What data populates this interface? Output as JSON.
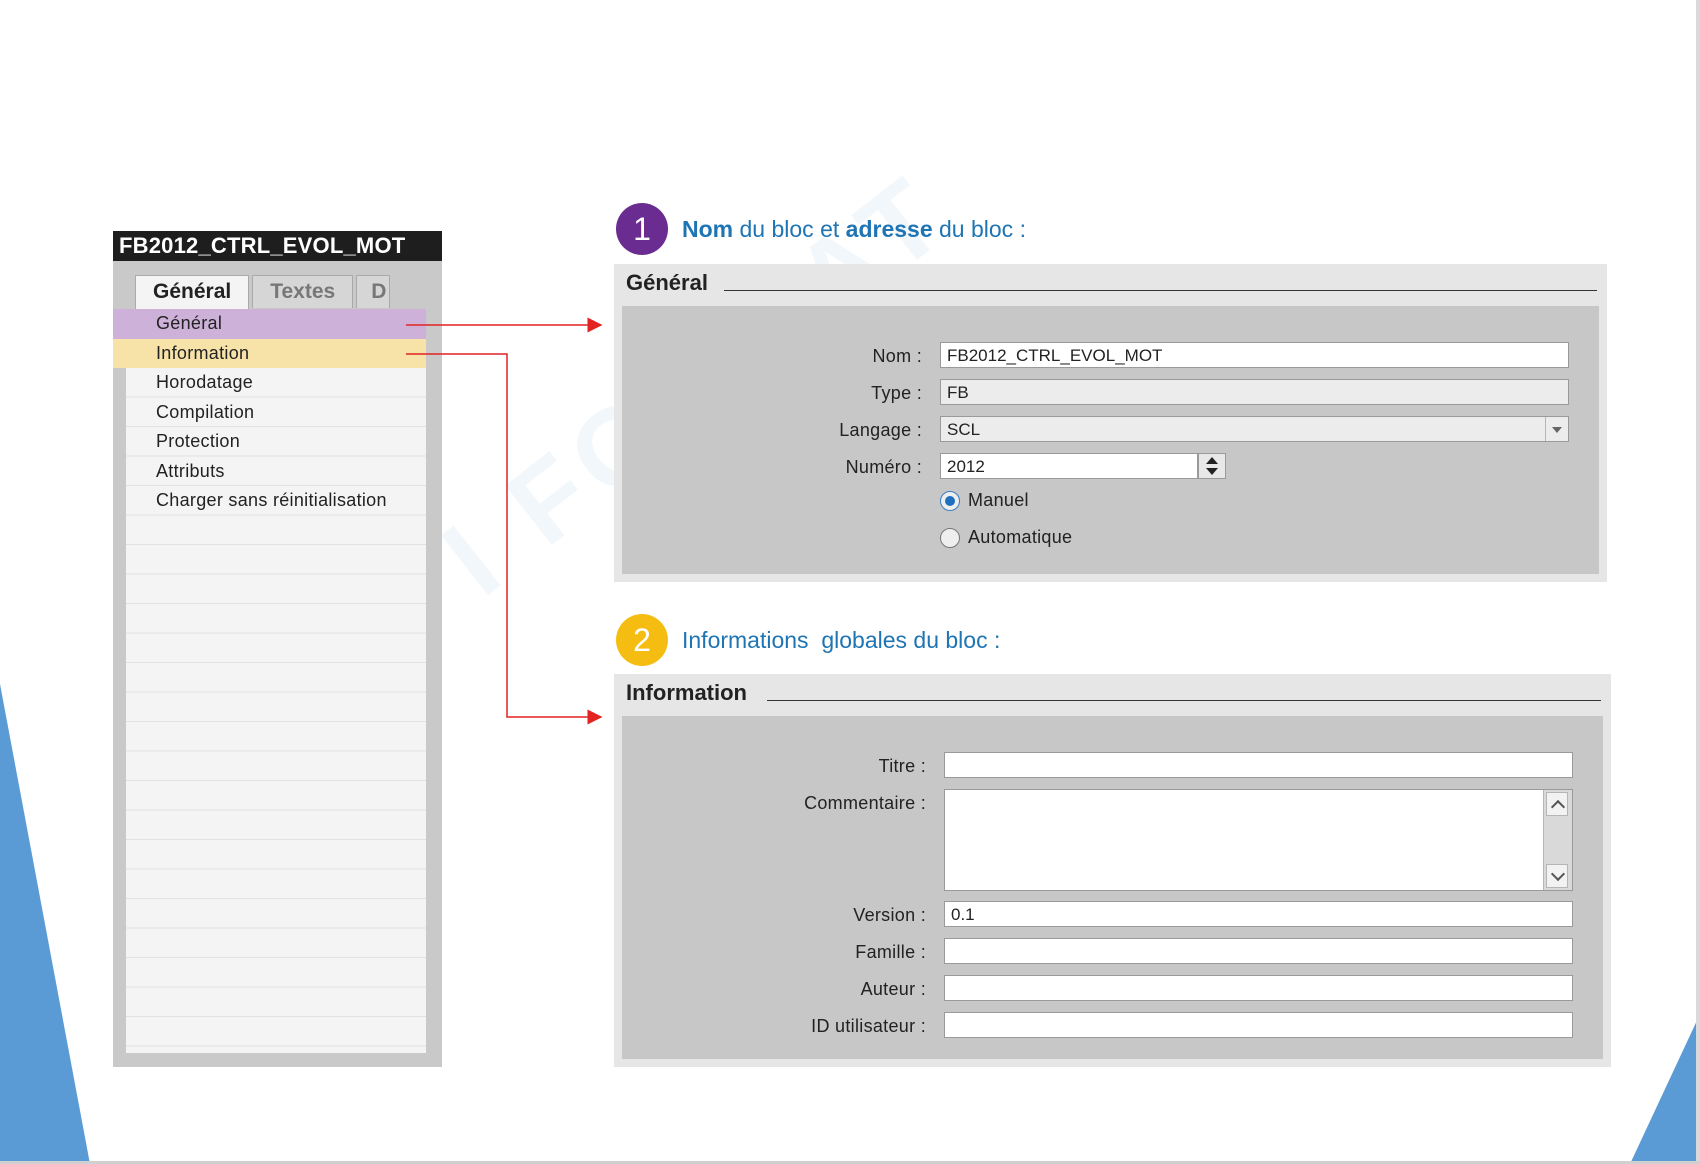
{
  "colors": {
    "accent_blue": "#1f74b3",
    "badge_purple": "#6a2c91",
    "badge_yellow": "#f5bd12",
    "selection_purple": "#cdb1d9",
    "selection_yellow": "#f7e3a8",
    "connector_red": "#e32222"
  },
  "left_panel": {
    "title": "FB2012_CTRL_EVOL_MOT",
    "tabs": [
      {
        "label": "Général",
        "active": true
      },
      {
        "label": "Textes",
        "active": false
      },
      {
        "label": "D",
        "active": false
      }
    ],
    "nav": [
      {
        "label": "Général",
        "highlight": "purple"
      },
      {
        "label": "Information",
        "highlight": "yellow"
      },
      {
        "label": "Horodatage"
      },
      {
        "label": "Compilation"
      },
      {
        "label": "Protection"
      },
      {
        "label": "Attributs"
      },
      {
        "label": "Charger sans réinitialisation"
      }
    ]
  },
  "section1": {
    "number": "1",
    "heading_bold1": "Nom",
    "heading_mid": " du bloc et ",
    "heading_bold2": "adresse",
    "heading_end": " du bloc :",
    "panel_title": "Général",
    "fields": {
      "nom": {
        "label": "Nom :",
        "value": "FB2012_CTRL_EVOL_MOT"
      },
      "type": {
        "label": "Type :",
        "value": "FB"
      },
      "langage": {
        "label": "Langage :",
        "value": "SCL"
      },
      "numero": {
        "label": "Numéro :",
        "value": "2012"
      }
    },
    "radios": [
      {
        "label": "Manuel",
        "checked": true
      },
      {
        "label": "Automatique",
        "checked": false
      }
    ]
  },
  "section2": {
    "number": "2",
    "heading": "Informations  globales du bloc :",
    "panel_title": "Information",
    "fields": {
      "titre": {
        "label": "Titre :",
        "value": ""
      },
      "commentaire": {
        "label": "Commentaire :",
        "value": ""
      },
      "version": {
        "label": "Version :",
        "value": "0.1"
      },
      "famille": {
        "label": "Famille :",
        "value": ""
      },
      "auteur": {
        "label": "Auteur :",
        "value": ""
      },
      "id_utilisateur": {
        "label": "ID utilisateur :",
        "value": ""
      }
    }
  }
}
